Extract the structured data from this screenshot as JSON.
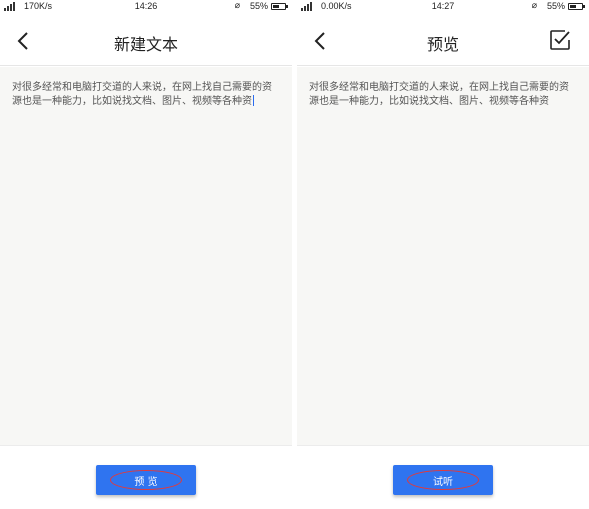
{
  "colors": {
    "accent": "#2f74f0",
    "annotation_ring": "#e33a3a",
    "content_bg": "#f7f7f5"
  },
  "left_screen": {
    "status": {
      "speed": "170K/s",
      "time": "14:26",
      "battery": "55%"
    },
    "title": "新建文本",
    "back_icon": "chevron-left-icon",
    "text": "对很多经常和电脑打交道的人来说，在网上找自己需要的资\n源也是一种能力，比如说找文档、图片、视频等各种资",
    "button_label": "预 览"
  },
  "right_screen": {
    "status": {
      "speed": "0.00K/s",
      "time": "14:27",
      "battery": "55%"
    },
    "title": "预览",
    "back_icon": "chevron-left-icon",
    "confirm_icon": "checkbox-check-icon",
    "text": "对很多经常和电脑打交道的人来说，在网上找自己需要的资\n源也是一种能力，比如说找文档、图片、视频等各种资",
    "button_label": "试听"
  }
}
